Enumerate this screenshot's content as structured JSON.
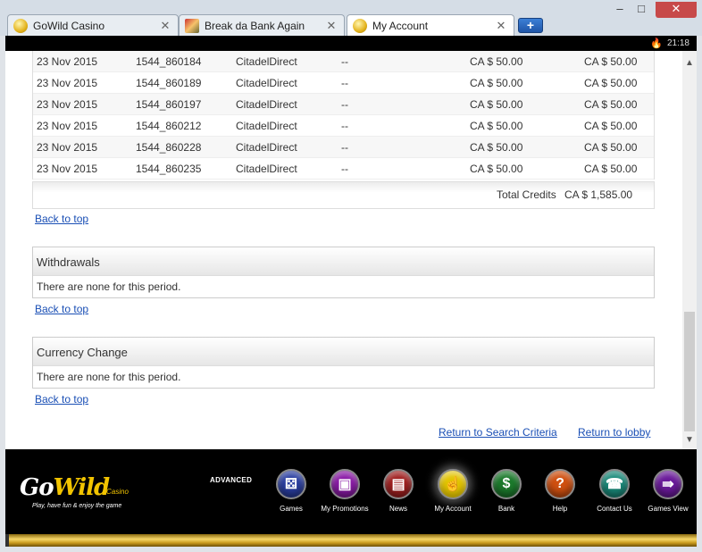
{
  "tabs": [
    {
      "label": "GoWild Casino"
    },
    {
      "label": "Break da Bank Again"
    },
    {
      "label": "My Account"
    }
  ],
  "window_controls": {
    "minimize": "–",
    "maximize": "□",
    "close": "✕"
  },
  "status": {
    "time": "21:18"
  },
  "transactions": [
    {
      "date": "23 Nov 2015",
      "ref": "1544_860184",
      "method": "CitadelDirect",
      "note": "--",
      "amount": "CA $ 50.00",
      "credited": "CA $ 50.00"
    },
    {
      "date": "23 Nov 2015",
      "ref": "1544_860189",
      "method": "CitadelDirect",
      "note": "--",
      "amount": "CA $ 50.00",
      "credited": "CA $ 50.00"
    },
    {
      "date": "23 Nov 2015",
      "ref": "1544_860197",
      "method": "CitadelDirect",
      "note": "--",
      "amount": "CA $ 50.00",
      "credited": "CA $ 50.00"
    },
    {
      "date": "23 Nov 2015",
      "ref": "1544_860212",
      "method": "CitadelDirect",
      "note": "--",
      "amount": "CA $ 50.00",
      "credited": "CA $ 50.00"
    },
    {
      "date": "23 Nov 2015",
      "ref": "1544_860228",
      "method": "CitadelDirect",
      "note": "--",
      "amount": "CA $ 50.00",
      "credited": "CA $ 50.00"
    },
    {
      "date": "23 Nov 2015",
      "ref": "1544_860235",
      "method": "CitadelDirect",
      "note": "--",
      "amount": "CA $ 50.00",
      "credited": "CA $ 50.00"
    }
  ],
  "total": {
    "label": "Total Credits",
    "value": "CA $ 1,585.00"
  },
  "back_to_top": "Back to top",
  "withdrawals": {
    "title": "Withdrawals",
    "empty": "There are none for this period."
  },
  "currency_change": {
    "title": "Currency Change",
    "empty": "There are none for this period."
  },
  "links": {
    "return_search": "Return to Search Criteria",
    "return_lobby": "Return to lobby"
  },
  "footer": {
    "logo_text": "GoWild",
    "logo_sub": "Casino",
    "tagline": "Play, have fun & enjoy the game",
    "advanced": "ADVANCED",
    "nav": [
      {
        "label": "Games",
        "icon": "dice-icon",
        "glyph": "⚄",
        "color": "#2a3ea0"
      },
      {
        "label": "My Promotions",
        "icon": "gift-icon",
        "glyph": "▣",
        "color": "#8a1aa6"
      },
      {
        "label": "News",
        "icon": "newspaper-icon",
        "glyph": "▤",
        "color": "#a02020"
      },
      {
        "label": "My Account",
        "icon": "account-icon",
        "glyph": "☝",
        "color": "#e3c400"
      },
      {
        "label": "Bank",
        "icon": "dollar-icon",
        "glyph": "$",
        "color": "#1c7a2c"
      },
      {
        "label": "Help",
        "icon": "help-icon",
        "glyph": "?",
        "color": "#d05010"
      },
      {
        "label": "Contact Us",
        "icon": "phone-icon",
        "glyph": "☎",
        "color": "#1a8a7a"
      },
      {
        "label": "Games View",
        "icon": "games-view-icon",
        "glyph": "⇛",
        "color": "#6a1a9a"
      }
    ]
  }
}
